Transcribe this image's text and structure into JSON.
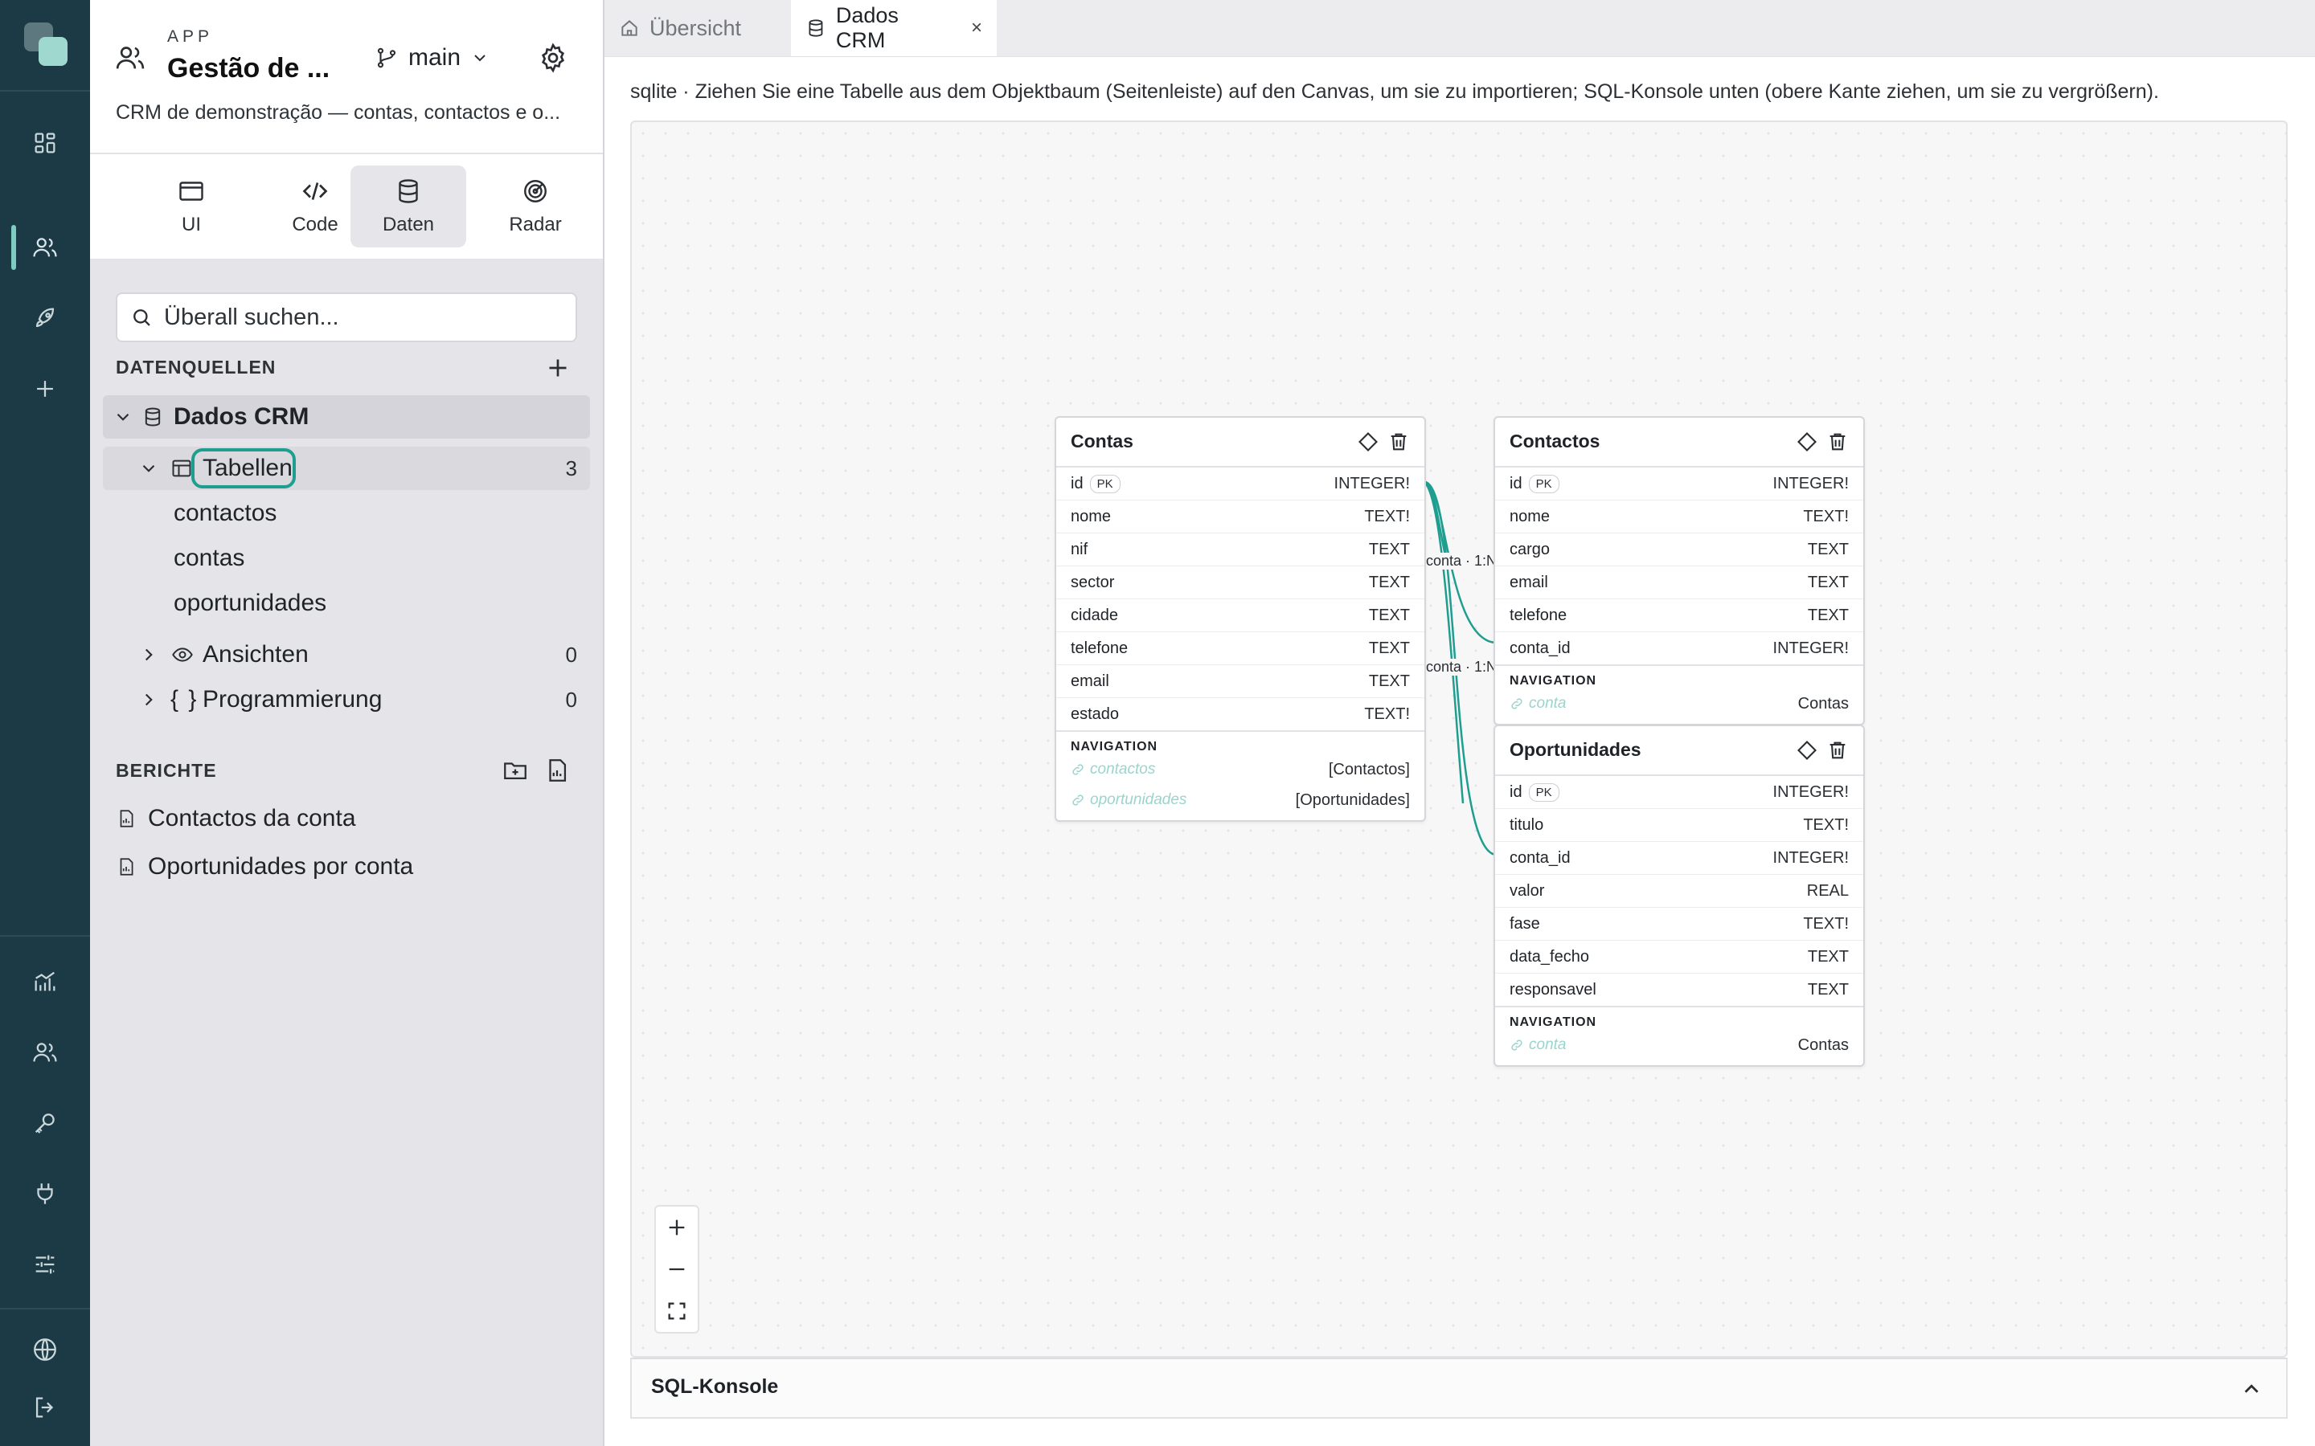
{
  "app": {
    "kicker": "APP",
    "title": "Gestão de ...",
    "branch": "main",
    "description": "CRM de demonstração — contas, contactos e o..."
  },
  "modes": [
    {
      "label": "UI",
      "icon": "window-icon"
    },
    {
      "label": "Code",
      "icon": "code-icon"
    },
    {
      "label": "Daten",
      "icon": "database-icon",
      "active": true
    },
    {
      "label": "Radar",
      "icon": "radar-icon"
    }
  ],
  "search": {
    "placeholder": "Überall suchen..."
  },
  "datasources": {
    "label": "DATENQUELLEN",
    "source": "Dados CRM",
    "tables": {
      "label": "Tabellen",
      "count": "3",
      "items": [
        "contactos",
        "contas",
        "oportunidades"
      ]
    },
    "views": {
      "label": "Ansichten",
      "count": "0"
    },
    "programming": {
      "label": "Programmierung",
      "count": "0"
    }
  },
  "reports": {
    "label": "BERICHTE",
    "items": [
      "Contactos da conta",
      "Oportunidades por conta"
    ]
  },
  "tabs": [
    {
      "label": "Übersicht",
      "active": false
    },
    {
      "label": "Dados CRM",
      "active": true,
      "close": "×"
    }
  ],
  "hint": "sqlite · Ziehen Sie eine Tabelle aus dem Objektbaum (Seitenleiste) auf den Canvas, um sie zu importieren; SQL-Konsole unten (obere Kante ziehen, um sie zu vergrößern).",
  "entities": {
    "contas": {
      "title": "Contas",
      "columns": [
        {
          "name": "id",
          "pk": "PK",
          "type": "INTEGER!"
        },
        {
          "name": "nome",
          "type": "TEXT!"
        },
        {
          "name": "nif",
          "type": "TEXT"
        },
        {
          "name": "sector",
          "type": "TEXT"
        },
        {
          "name": "cidade",
          "type": "TEXT"
        },
        {
          "name": "telefone",
          "type": "TEXT"
        },
        {
          "name": "email",
          "type": "TEXT"
        },
        {
          "name": "estado",
          "type": "TEXT!"
        }
      ],
      "nav_label": "NAVIGATION",
      "nav": [
        {
          "name": "contactos",
          "target": "[Contactos]"
        },
        {
          "name": "oportunidades",
          "target": "[Oportunidades]"
        }
      ]
    },
    "contactos": {
      "title": "Contactos",
      "columns": [
        {
          "name": "id",
          "pk": "PK",
          "type": "INTEGER!"
        },
        {
          "name": "nome",
          "type": "TEXT!"
        },
        {
          "name": "cargo",
          "type": "TEXT"
        },
        {
          "name": "email",
          "type": "TEXT"
        },
        {
          "name": "telefone",
          "type": "TEXT"
        },
        {
          "name": "conta_id",
          "type": "INTEGER!"
        }
      ],
      "nav_label": "NAVIGATION",
      "nav": [
        {
          "name": "conta",
          "target": "Contas"
        }
      ]
    },
    "oportunidades": {
      "title": "Oportunidades",
      "columns": [
        {
          "name": "id",
          "pk": "PK",
          "type": "INTEGER!"
        },
        {
          "name": "titulo",
          "type": "TEXT!"
        },
        {
          "name": "conta_id",
          "type": "INTEGER!"
        },
        {
          "name": "valor",
          "type": "REAL"
        },
        {
          "name": "fase",
          "type": "TEXT!"
        },
        {
          "name": "data_fecho",
          "type": "TEXT"
        },
        {
          "name": "responsavel",
          "type": "TEXT"
        }
      ],
      "nav_label": "NAVIGATION",
      "nav": [
        {
          "name": "conta",
          "target": "Contas"
        }
      ]
    }
  },
  "relations": [
    {
      "label": "conta · 1:N",
      "from": "contas",
      "to": "contactos"
    },
    {
      "label": "conta · 1:N",
      "from": "contas",
      "to": "oportunidades"
    }
  ],
  "sql_console": {
    "label": "SQL-Konsole"
  },
  "colors": {
    "rail": "#1b3a45",
    "accent": "#1f9e8f",
    "relation_line": "#1f9e8f",
    "sidebar_bg": "#e4e4e9"
  }
}
